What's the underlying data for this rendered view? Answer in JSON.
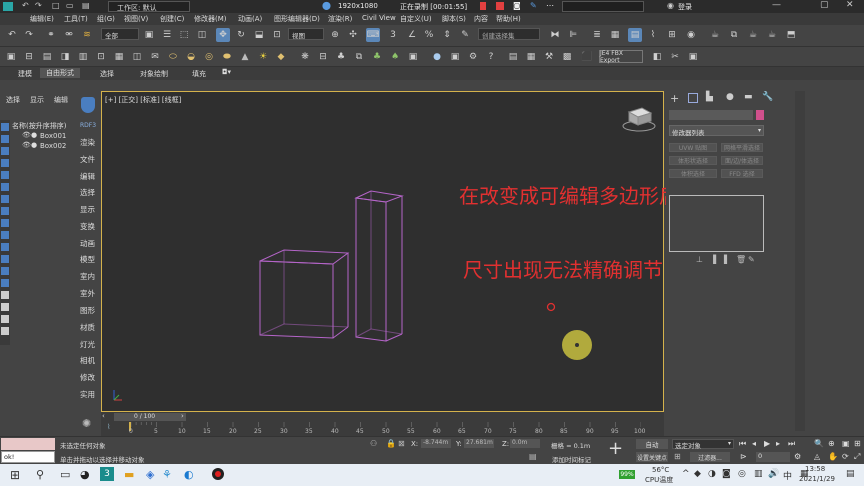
{
  "titlebar": {
    "workspace_label": "工作区: 默认",
    "resolution": "1920x1080",
    "recording": "正在录制 [00:01:55]",
    "login": "登录"
  },
  "menu": [
    "编辑(E)",
    "工具(T)",
    "组(G)",
    "视图(V)",
    "创建(C)",
    "修改器(M)",
    "动画(A)",
    "图形编辑器(D)",
    "渲染(R)",
    "Civil View",
    "自定义(U)",
    "脚本(S)",
    "内容",
    "帮助(H)"
  ],
  "toolbar": {
    "filter_dropdown": "全部",
    "viewport_dropdown": "视图",
    "selection_set": "创建选择集"
  },
  "toolbar2": {
    "fbx_label": "JE4 FBX Export"
  },
  "ribbon_tabs": [
    "建模",
    "自由形式",
    "选择",
    "对象绘制",
    "填充"
  ],
  "scene_explorer": {
    "tabs": [
      "选择",
      "显示",
      "编辑"
    ],
    "header": "名称(按升序排序)",
    "items": [
      "Box001",
      "Box002"
    ]
  },
  "command_column": {
    "top_label": "RDF3",
    "items": [
      "渲染",
      "文件",
      "编辑",
      "选择",
      "显示",
      "变换",
      "动画",
      "模型",
      "室内",
      "室外",
      "图形",
      "材质",
      "灯光",
      "相机",
      "修改",
      "实用"
    ]
  },
  "viewport": {
    "label": "[+] [正交] [标准] [线框]",
    "caption_line1": "在改变成可编辑多边形后，",
    "caption_line2": "尺寸出现无法精确调节"
  },
  "command_panel": {
    "modifier_list": "修改器列表",
    "buttons": [
      "UVW 贴图",
      "网格平滑选择",
      "体形状选择",
      "面/边/体选择",
      "体积选择",
      "FFD 选择"
    ]
  },
  "timeline": {
    "frame_label": "0 / 100",
    "ticks": [
      "0",
      "5",
      "10",
      "15",
      "20",
      "25",
      "30",
      "35",
      "40",
      "45",
      "50",
      "55",
      "60",
      "65",
      "70",
      "75",
      "80",
      "85",
      "90",
      "95",
      "100"
    ]
  },
  "status": {
    "prompt1": "未选定任何对象",
    "prompt2": "单击并拖动以选择并移动对象",
    "input_value": "ok!",
    "x_label": "X:",
    "x_value": "-8.744m",
    "y_label": "Y:",
    "y_value": "27.681m",
    "z_label": "Z:",
    "z_value": "0.0m",
    "grid": "栅格 = 0.1m",
    "add_time_tag": "添加时间标记",
    "auto_key": "自动",
    "selected_object": "选定对象",
    "set_key": "设置关键点",
    "key_filters": "过滤器...",
    "frame_value": "0"
  },
  "taskbar": {
    "temperature": "56°C",
    "cpu_label": "CPU温度",
    "battery": "99%",
    "ime": "中",
    "time": "13:58",
    "date": "2021/1/29"
  },
  "colors": {
    "viewport_border": "#d4b24c",
    "wireframe": "#b565c9",
    "caption": "#e23030",
    "active_button": "#5b87b8"
  }
}
